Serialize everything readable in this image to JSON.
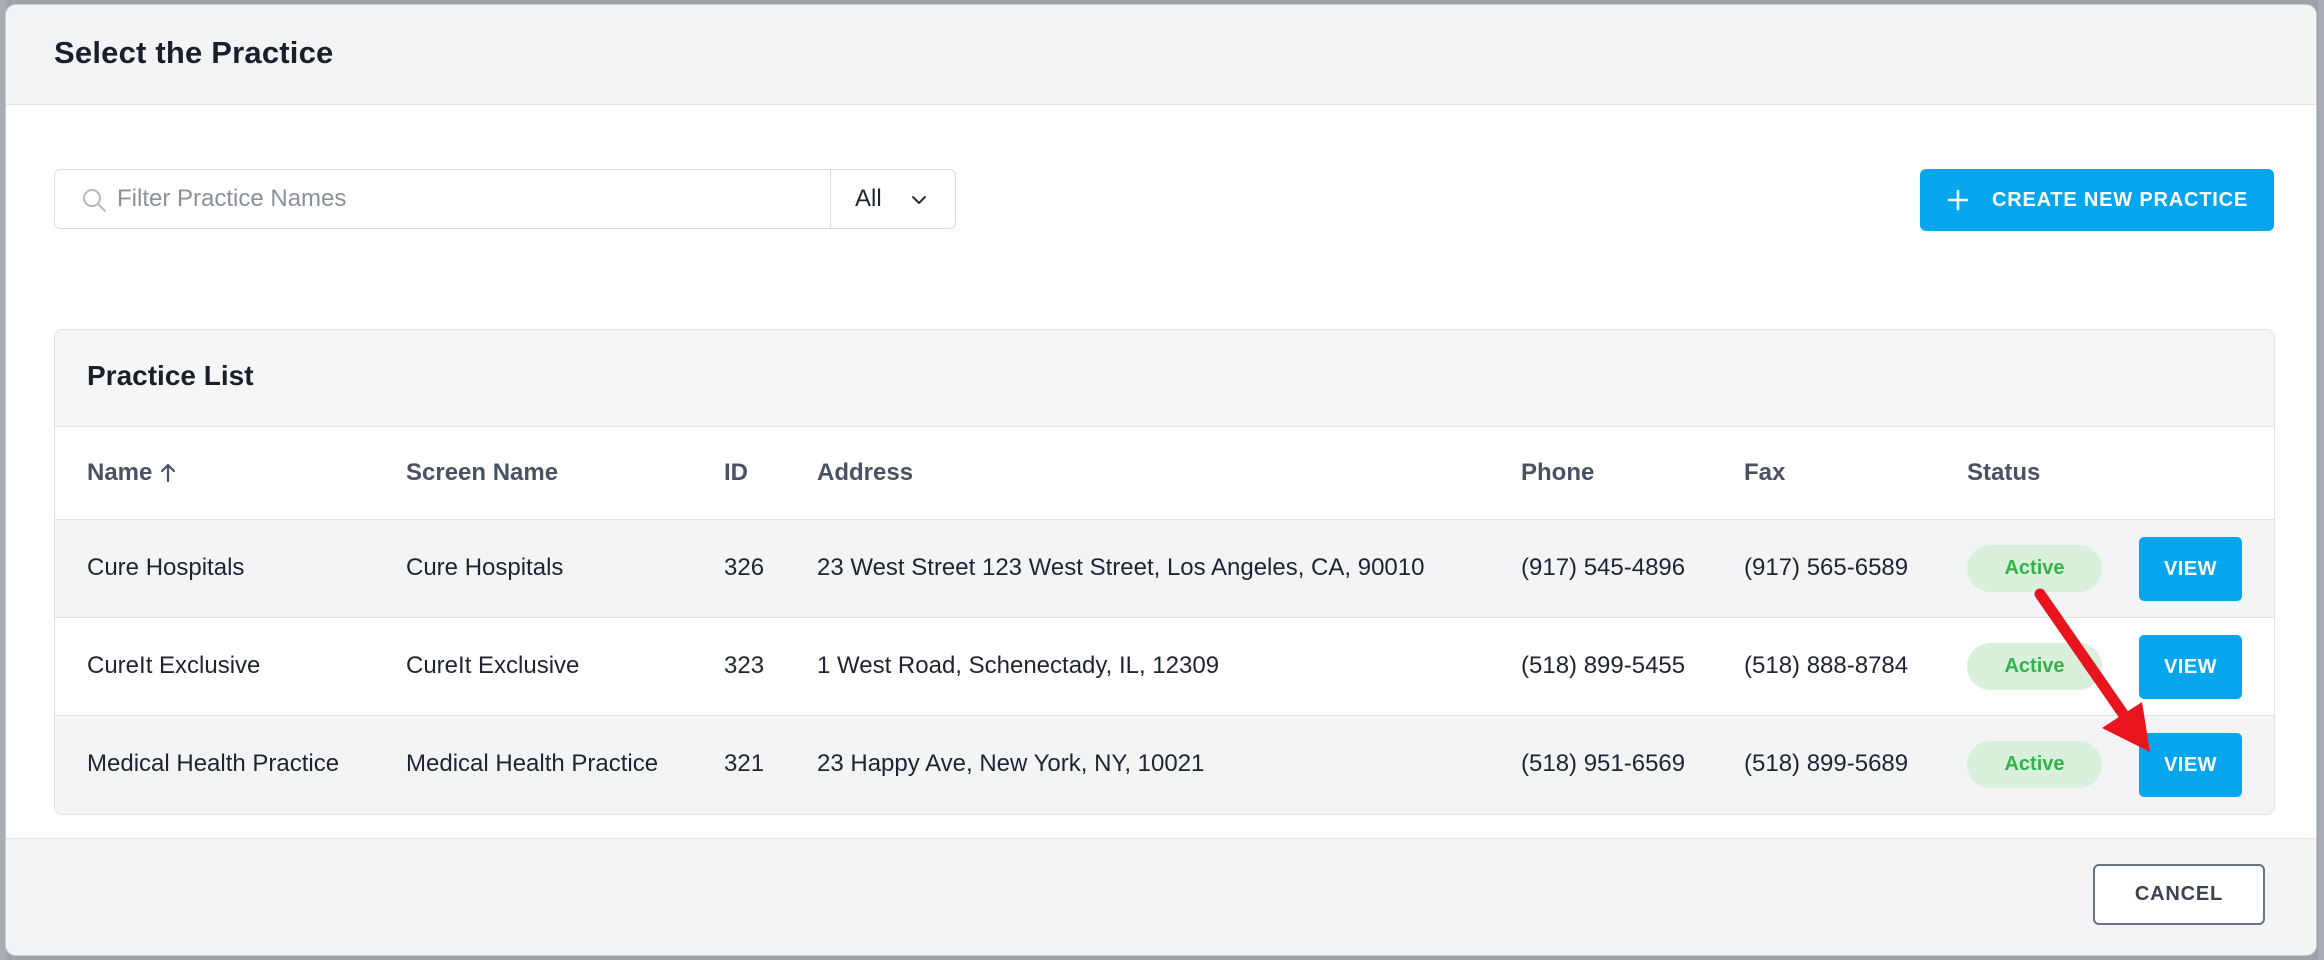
{
  "modal": {
    "title": "Select the Practice"
  },
  "filter": {
    "search_placeholder": "Filter Practice Names",
    "search_value": "",
    "status_select_value": "All",
    "create_button_label": "CREATE NEW PRACTICE"
  },
  "practice_list": {
    "title": "Practice List",
    "columns": {
      "name": "Name",
      "screen_name": "Screen Name",
      "id": "ID",
      "address": "Address",
      "phone": "Phone",
      "fax": "Fax",
      "status": "Status"
    },
    "sort": {
      "column": "name",
      "direction": "ascending",
      "icon": "arrow-up-icon"
    },
    "rows": [
      {
        "name": "Cure Hospitals",
        "screen_name": "Cure Hospitals",
        "id": "326",
        "address": "23 West Street 123 West Street, Los Angeles, CA, 90010",
        "phone": "(917) 545-4896",
        "fax": "(917) 565-6589",
        "status": "Active",
        "action": "VIEW"
      },
      {
        "name": "CureIt Exclusive",
        "screen_name": "CureIt Exclusive",
        "id": "323",
        "address": "1 West Road, Schenectady, IL, 12309",
        "phone": "(518) 899-5455",
        "fax": "(518) 888-8784",
        "status": "Active",
        "action": "VIEW"
      },
      {
        "name": "Medical Health Practice",
        "screen_name": "Medical Health Practice",
        "id": "321",
        "address": "23 Happy Ave, New York, NY, 10021",
        "phone": "(518) 951-6569",
        "fax": "(518) 899-5689",
        "status": "Active",
        "action": "VIEW"
      }
    ]
  },
  "footer": {
    "cancel_label": "CANCEL"
  },
  "colors": {
    "accent": "#06a6ee",
    "active_badge_bg": "#d8f0dc",
    "active_badge_text": "#36b24c",
    "annotation_arrow": "#e8141e"
  },
  "icons": {
    "search": "search-icon",
    "select": "chevron-down-icon",
    "create": "plus-icon",
    "sort": "arrow-up-icon"
  }
}
